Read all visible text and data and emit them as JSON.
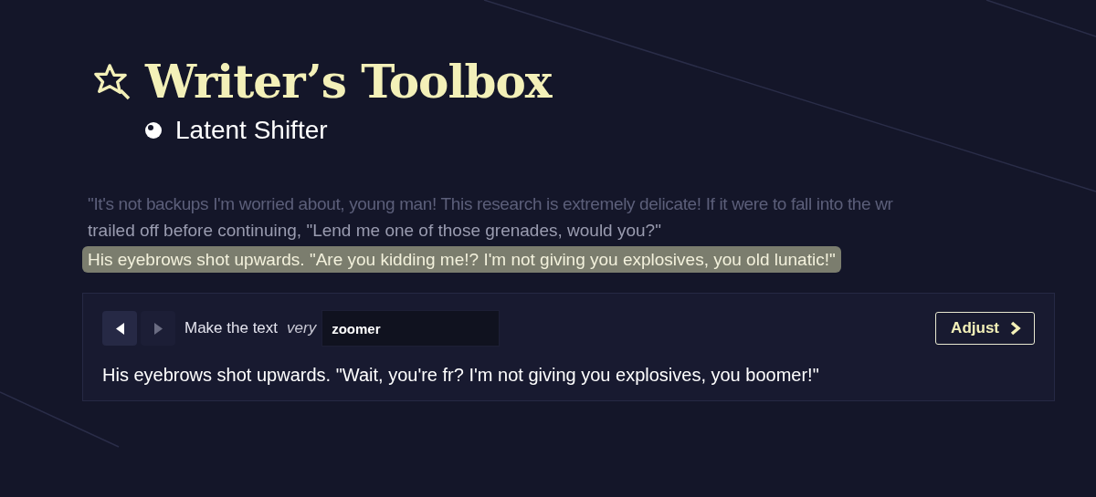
{
  "header": {
    "title": "Writer’s Toolbox",
    "subtitle": "Latent Shifter"
  },
  "passage": [
    {
      "text": "\"It's not backups I'm worried about, young man! This research is extremely delicate! If it were to fall into the wr",
      "selected": false
    },
    {
      "text": "trailed off before continuing, \"Lend me one of those grenades, would you?\"",
      "selected": false
    },
    {
      "text": "His eyebrows shot upwards. \"Are you kidding me!? I'm not giving you explosives, you old lunatic!\"",
      "selected": true
    }
  ],
  "editor": {
    "prev": {
      "disabled": false
    },
    "next": {
      "disabled": true
    },
    "label": "Make the text",
    "modifier": "very",
    "style_field": {
      "value": "zoomer"
    },
    "button": "Adjust",
    "result": "His eyebrows shot upwards. \"Wait, you're fr? I'm not giving you explosives, you boomer!\""
  }
}
